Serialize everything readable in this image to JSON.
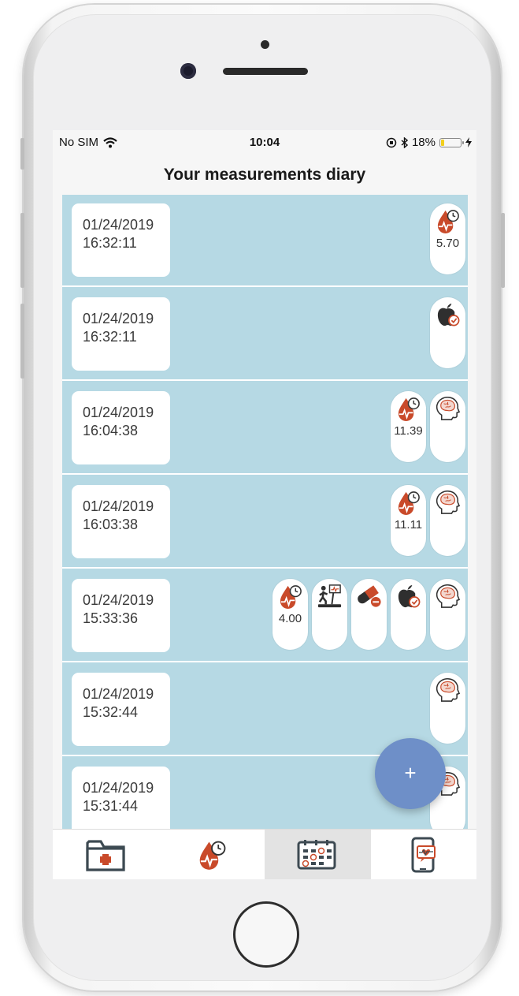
{
  "status_bar": {
    "carrier": "No SIM",
    "time": "10:04",
    "battery_percent": "18%",
    "battery_level": 0.18
  },
  "header": {
    "title": "Your measurements diary"
  },
  "entries": [
    {
      "date": "01/24/2019",
      "time": "16:32:11",
      "badges": [
        {
          "icon": "blood-glucose-icon",
          "value": "5.70"
        }
      ]
    },
    {
      "date": "01/24/2019",
      "time": "16:32:11",
      "badges": [
        {
          "icon": "apple-food-icon",
          "value": ""
        }
      ]
    },
    {
      "date": "01/24/2019",
      "time": "16:04:38",
      "badges": [
        {
          "icon": "blood-glucose-icon",
          "value": "11.39"
        },
        {
          "icon": "brain-mood-icon",
          "value": ""
        }
      ]
    },
    {
      "date": "01/24/2019",
      "time": "16:03:38",
      "badges": [
        {
          "icon": "blood-glucose-icon",
          "value": "11.11"
        },
        {
          "icon": "brain-mood-icon",
          "value": ""
        }
      ]
    },
    {
      "date": "01/24/2019",
      "time": "15:33:36",
      "badges": [
        {
          "icon": "blood-glucose-icon",
          "value": "4.00"
        },
        {
          "icon": "treadmill-activity-icon",
          "value": ""
        },
        {
          "icon": "pill-medication-icon",
          "value": ""
        },
        {
          "icon": "apple-food-icon",
          "value": ""
        },
        {
          "icon": "brain-mood-icon",
          "value": ""
        }
      ]
    },
    {
      "date": "01/24/2019",
      "time": "15:32:44",
      "badges": [
        {
          "icon": "brain-mood-icon",
          "value": ""
        }
      ]
    },
    {
      "date": "01/24/2019",
      "time": "15:31:44",
      "badges": [
        {
          "icon": "brain-mood-icon",
          "value": ""
        }
      ]
    }
  ],
  "fab": {
    "label": "+"
  },
  "tabs": [
    {
      "icon": "medical-folder-icon",
      "active": false
    },
    {
      "icon": "blood-glucose-icon",
      "active": false
    },
    {
      "icon": "calendar-diary-icon",
      "active": true
    },
    {
      "icon": "phone-heart-icon",
      "active": false
    }
  ],
  "colors": {
    "list_background": "#b6d9e4",
    "accent_red": "#c94a2a",
    "dark_icon": "#3a3a3a",
    "fab": "#6e8fc8"
  }
}
